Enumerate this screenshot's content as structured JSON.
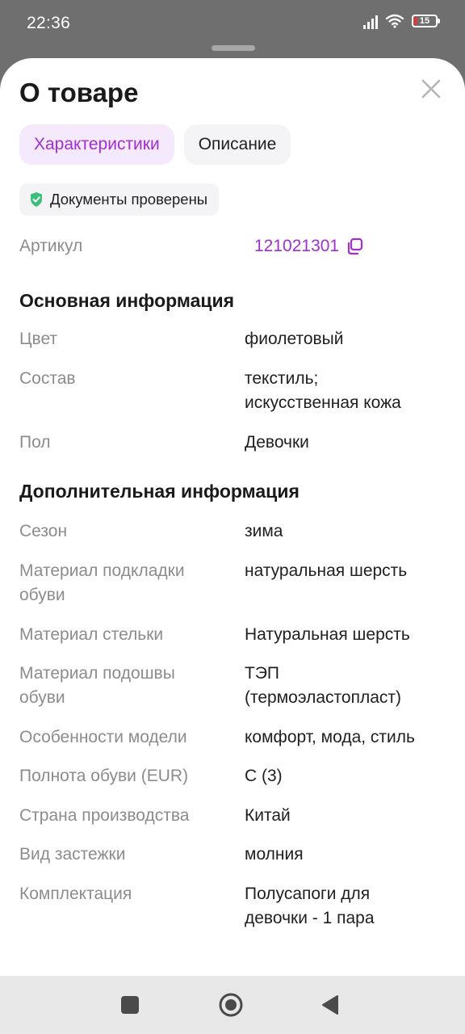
{
  "status_bar": {
    "time": "22:36",
    "battery": "15"
  },
  "sheet": {
    "title": "О товаре",
    "tabs": [
      {
        "label": "Характеристики",
        "active": true
      },
      {
        "label": "Описание",
        "active": false
      }
    ],
    "documents_badge": "Документы проверены",
    "article": {
      "label": "Артикул",
      "value": "121021301"
    },
    "main_info": {
      "heading": "Основная информация",
      "rows": [
        {
          "label": "Цвет",
          "value": "фиолетовый"
        },
        {
          "label": "Состав",
          "value": "текстиль;",
          "value_line2": "искусственная кожа"
        },
        {
          "label": "Пол",
          "value": "Девочки"
        }
      ]
    },
    "extra_info": {
      "heading": "Дополнительная информация",
      "rows": [
        {
          "label": "Сезон",
          "value": "зима"
        },
        {
          "label": "Материал подкладки",
          "label_line2": "обуви",
          "value": "натуральная шерсть"
        },
        {
          "label": "Материал стельки",
          "value": "Натуральная шерсть"
        },
        {
          "label": "Материал подошвы",
          "label_line2": "обуви",
          "value": "ТЭП",
          "value_line2": "(термоэластопласт)"
        },
        {
          "label": "Особенности модели",
          "value": "комфорт, мода, стиль"
        },
        {
          "label": "Полнота обуви (EUR)",
          "value": "C (3)"
        },
        {
          "label": "Страна производства",
          "value": "Китай"
        },
        {
          "label": "Вид застежки",
          "value": "молния"
        },
        {
          "label": "Комплектация",
          "value": "Полусапоги для",
          "value_line2": "девочки - 1 пара"
        }
      ]
    }
  },
  "colors": {
    "accent": "#a12fd0",
    "accent_bg": "#f5e9fd",
    "verified": "#3bbf7a"
  },
  "icons": [
    "close-icon",
    "shield-check-icon",
    "copy-icon",
    "stop-square-icon",
    "home-circle-icon",
    "back-triangle-icon"
  ]
}
